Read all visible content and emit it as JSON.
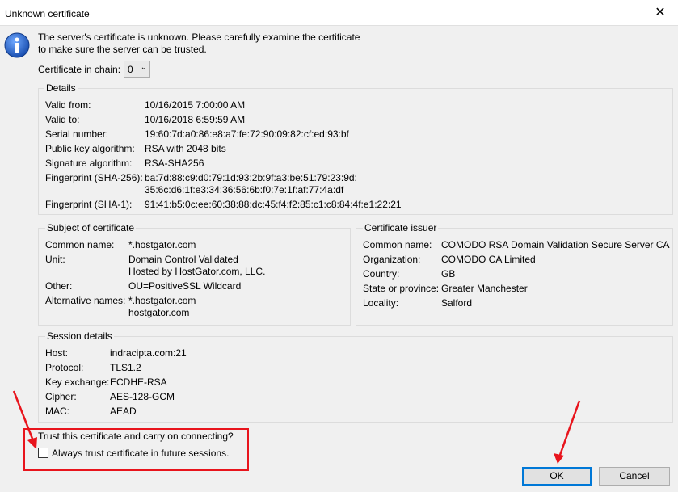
{
  "window": {
    "title": "Unknown certificate",
    "close_glyph": "✕"
  },
  "message": {
    "line1": "The server's certificate is unknown. Please carefully examine the certificate",
    "line2": "to make sure the server can be trusted."
  },
  "chain": {
    "label": "Certificate in chain:",
    "value": "0"
  },
  "details": {
    "title": "Details",
    "valid_from_label": "Valid from:",
    "valid_from": "10/16/2015 7:00:00 AM",
    "valid_to_label": "Valid to:",
    "valid_to": "10/16/2018 6:59:59 AM",
    "serial_label": "Serial number:",
    "serial": "19:60:7d:a0:86:e8:a7:fe:72:90:09:82:cf:ed:93:bf",
    "pubkey_label": "Public key algorithm:",
    "pubkey": "RSA with 2048 bits",
    "sigalg_label": "Signature algorithm:",
    "sigalg": "RSA-SHA256",
    "fp256_label": "Fingerprint (SHA-256):",
    "fp256_line1": "ba:7d:88:c9:d0:79:1d:93:2b:9f:a3:be:51:79:23:9d:",
    "fp256_line2": "35:6c:d6:1f:e3:34:36:56:6b:f0:7e:1f:af:77:4a:df",
    "fp1_label": "Fingerprint (SHA-1):",
    "fp1": "91:41:b5:0c:ee:60:38:88:dc:45:f4:f2:85:c1:c8:84:4f:e1:22:21"
  },
  "subject": {
    "title": "Subject of certificate",
    "cn_label": "Common name:",
    "cn": "*.hostgator.com",
    "unit_label": "Unit:",
    "unit_line1": "Domain Control Validated",
    "unit_line2": "Hosted by HostGator.com, LLC.",
    "other_label": "Other:",
    "other": "OU=PositiveSSL Wildcard",
    "alt_label": "Alternative names:",
    "alt_line1": "*.hostgator.com",
    "alt_line2": "hostgator.com"
  },
  "issuer": {
    "title": "Certificate issuer",
    "cn_label": "Common name:",
    "cn": "COMODO RSA Domain Validation Secure Server CA",
    "org_label": "Organization:",
    "org": "COMODO CA Limited",
    "country_label": "Country:",
    "country": "GB",
    "state_label": "State or province:",
    "state": "Greater Manchester",
    "locality_label": "Locality:",
    "locality": "Salford"
  },
  "session": {
    "title": "Session details",
    "host_label": "Host:",
    "host": "indracipta.com:21",
    "protocol_label": "Protocol:",
    "protocol": "TLS1.2",
    "kex_label": "Key exchange:",
    "kex": "ECDHE-RSA",
    "cipher_label": "Cipher:",
    "cipher": "AES-128-GCM",
    "mac_label": "MAC:",
    "mac": "AEAD"
  },
  "trust": {
    "question": "Trust this certificate and carry on connecting?",
    "always_label": "Always trust certificate in future sessions.",
    "always_checked": false
  },
  "buttons": {
    "ok": "OK",
    "cancel": "Cancel"
  },
  "colors": {
    "annotation_red": "#e8141c",
    "focus_blue": "#0078d7",
    "info_blue": "#1e5fbf"
  }
}
